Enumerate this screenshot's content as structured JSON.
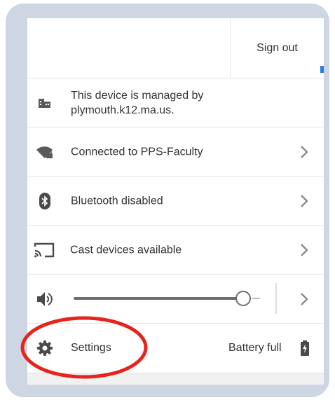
{
  "header": {
    "sign_out_label": "Sign out"
  },
  "managed": {
    "text_line1": "This device is managed by",
    "text_line2": "plymouth.k12.ma.us.",
    "icon": "building-icon"
  },
  "network": {
    "label": "Connected to PPS-Faculty",
    "icon": "wifi-locked-icon"
  },
  "bluetooth": {
    "label": "Bluetooth disabled",
    "icon": "bluetooth-icon"
  },
  "cast": {
    "label": "Cast devices available",
    "icon": "cast-icon"
  },
  "volume": {
    "level": 0.95,
    "icon": "speaker-icon"
  },
  "settings": {
    "label": "Settings",
    "icon": "gear-icon"
  },
  "battery": {
    "label": "Battery full",
    "icon": "battery-icon"
  },
  "annotation": {
    "color": "#e8231c"
  },
  "colors": {
    "frame": "#cdd6e2",
    "accent": "#2a7de1",
    "text": "#333333",
    "icon": "#555555"
  }
}
